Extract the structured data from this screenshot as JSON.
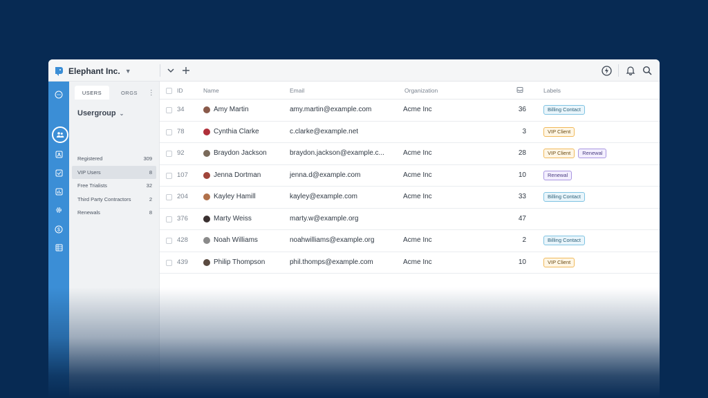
{
  "app": {
    "brand_name": "Elephant Inc.",
    "accent_color": "#3b8ed6",
    "background_color": "#072a53"
  },
  "topbar": {
    "icons": [
      "chevron-down-icon",
      "plus-icon",
      "lightning-icon",
      "bell-icon",
      "search-icon"
    ]
  },
  "rail": {
    "icons": [
      "chat-icon",
      "users-icon",
      "contact-icon",
      "check-icon",
      "chart-icon",
      "gear-icon",
      "dollar-icon",
      "table-icon"
    ],
    "active": "users-icon"
  },
  "panel": {
    "tabs": [
      "USERS",
      "ORGS"
    ],
    "active_tab": "USERS",
    "title": "Usergroup",
    "groups": [
      {
        "label": "Registered",
        "count": "309"
      },
      {
        "label": "VIP Users",
        "count": "8"
      },
      {
        "label": "Free Trialists",
        "count": "32"
      },
      {
        "label": "Third Party Contractors",
        "count": "2"
      },
      {
        "label": "Renewals",
        "count": "8"
      }
    ],
    "active_group": "VIP Users"
  },
  "table": {
    "headers": {
      "id": "ID",
      "name": "Name",
      "email": "Email",
      "organization": "Organization",
      "labels": "Labels"
    },
    "count_header_icon": "inbox-icon",
    "rows": [
      {
        "id": "34",
        "name": "Amy Martin",
        "email": "amy.martin@example.com",
        "org": "Acme Inc",
        "count": "36",
        "labels": [
          "Billing Contact"
        ]
      },
      {
        "id": "78",
        "name": "Cynthia Clarke",
        "email": "c.clarke@example.net",
        "org": "",
        "count": "3",
        "labels": [
          "VIP Client"
        ]
      },
      {
        "id": "92",
        "name": "Braydon Jackson",
        "email": "braydon.jackson@example.c...",
        "org": "Acme Inc",
        "count": "28",
        "labels": [
          "VIP Client",
          "Renewal"
        ]
      },
      {
        "id": "107",
        "name": "Jenna Dortman",
        "email": "jenna.d@example.com",
        "org": "Acme Inc",
        "count": "10",
        "labels": [
          "Renewal"
        ]
      },
      {
        "id": "204",
        "name": "Kayley Hamill",
        "email": "kayley@example.com",
        "org": "Acme Inc",
        "count": "33",
        "labels": [
          "Billing Contact"
        ]
      },
      {
        "id": "376",
        "name": "Marty Weiss",
        "email": "marty.w@example.org",
        "org": "",
        "count": "47",
        "labels": []
      },
      {
        "id": "428",
        "name": "Noah Williams",
        "email": "noahwilliams@example.org",
        "org": "Acme Inc",
        "count": "2",
        "labels": [
          "Billing Contact"
        ]
      },
      {
        "id": "439",
        "name": "Philip Thompson",
        "email": "phil.thomps@example.com",
        "org": "Acme Inc",
        "count": "10",
        "labels": [
          "VIP Client"
        ]
      }
    ],
    "avatar_colors": [
      "#8a5a4a",
      "#b0303a",
      "#7a6a5a",
      "#a0453a",
      "#b0704a",
      "#3a3030",
      "#8a8a8a",
      "#5a4a40"
    ]
  }
}
